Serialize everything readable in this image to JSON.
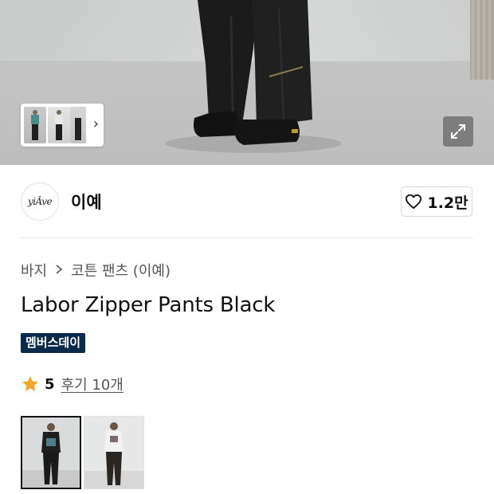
{
  "hero": {
    "image_alt": "model wearing black zipper pants",
    "gallery_next_icon": "chevron-right-icon",
    "expand_icon": "expand-arrows-icon"
  },
  "brand": {
    "logo_text": "yiÂve",
    "name": "이예",
    "like_icon": "heart-outline-icon",
    "like_count": "1.2만"
  },
  "breadcrumb": {
    "items": [
      "바지",
      "코튼 팬츠 (이예)"
    ],
    "separator_icon": "chevron-right-icon"
  },
  "product": {
    "title": "Labor Zipper Pants Black",
    "badge": "멤버스데이",
    "rating_icon": "star-icon",
    "rating": "5",
    "review_link": "후기 10개"
  },
  "colors": {
    "accent_badge": "#0a2b4a",
    "star": "#f5a623"
  },
  "color_options": [
    {
      "name": "black-tee-look",
      "selected": true
    },
    {
      "name": "white-tee-look",
      "selected": false
    }
  ]
}
